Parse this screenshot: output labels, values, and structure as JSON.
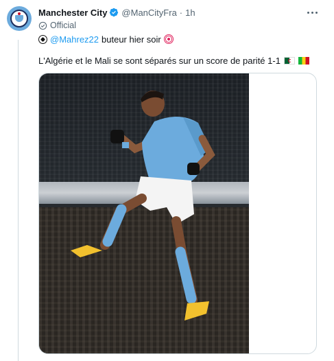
{
  "tweet": {
    "author_name": "Manchester City",
    "author_handle": "@ManCityFra",
    "separator": "·",
    "timestamp": "1h",
    "label": "Official",
    "line1_mention": "@Mahrez22",
    "line1_text": "buteur hier soir",
    "line2_text": "L'Algérie et le Mali se sont séparés sur un score de parité 1-1"
  },
  "colors": {
    "link": "#1d9bf0",
    "secondary_text": "#536471",
    "verified": "#1d9bf0",
    "mancity_blue": "#6cabdd"
  },
  "icons": [
    "mancity-crest-icon",
    "verified-badge-icon",
    "more-icon",
    "official-check-icon",
    "soccer-ball-icon",
    "target-icon",
    "algeria-flag-icon",
    "mali-flag-icon"
  ]
}
